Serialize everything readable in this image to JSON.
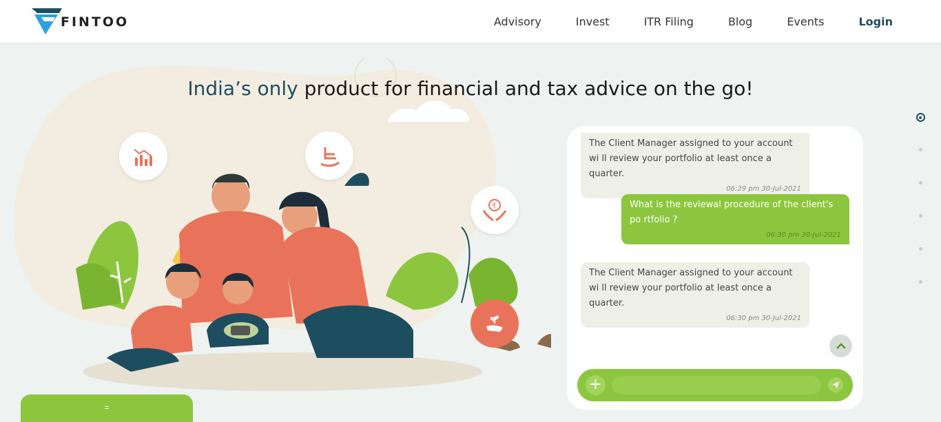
{
  "brand": {
    "name": "FINTOO"
  },
  "nav": {
    "items": [
      "Advisory",
      "Invest",
      "ITR Filing",
      "Blog",
      "Events"
    ],
    "login": "Login"
  },
  "hero": {
    "headline_accent": "India’s only",
    "headline_rest": " product for financial and tax advice on the go!"
  },
  "chat": {
    "messages": [
      {
        "direction": "in",
        "text": "The Client Manager assigned to your account wi ll review your portfolio at least once a quarter.",
        "time": "06:29 pm 30-Jul-2021"
      },
      {
        "direction": "out",
        "text": "What is the reviewal procedure of the client's po rtfolio ?",
        "time": "06:30 pm 30-Jul-2021"
      },
      {
        "direction": "in",
        "text": "The Client Manager assigned to your account wi ll review your portfolio at least once a quarter.",
        "time": "06:30 pm 30-Jul-2021"
      }
    ],
    "input_value": "",
    "input_placeholder": ""
  },
  "bottom_card": {
    "text": "="
  },
  "icons": {
    "chart": "bar-chart-icon",
    "rocking_chair": "rocking-chair-icon",
    "rupee_hands": "rupee-hands-icon",
    "plant_hand": "plant-hand-icon",
    "plus": "plus-icon",
    "send": "send-icon",
    "chevron_up": "chevron-up-icon"
  },
  "colors": {
    "accent_dark": "#1d4e5f",
    "brand_green": "#8cc63f",
    "icon_orange": "#e8735a",
    "logo_blue": "#2aa1e0"
  },
  "pager": {
    "count": 6,
    "active": 0
  }
}
